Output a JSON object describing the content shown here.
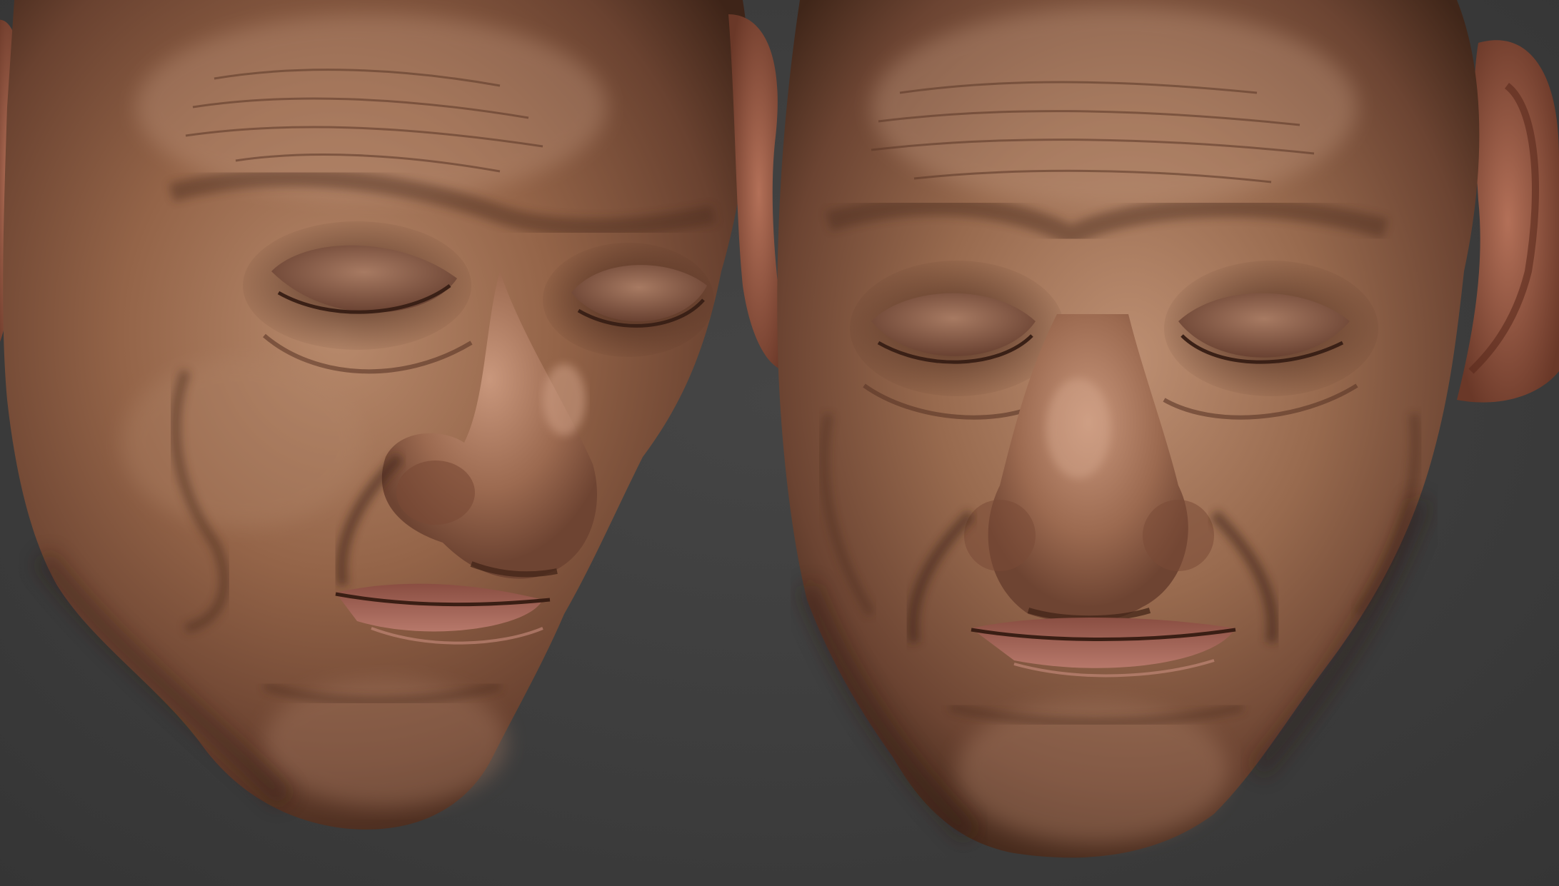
{
  "scene": {
    "background_color": "#3f3f3f",
    "skin_base": "#9a6a4e",
    "skin_shadow": "#4a2c1e",
    "skin_highlight": "#c4967a",
    "lip_color": "#a8665a",
    "subjects": [
      {
        "name": "sculpted-head-three-quarter",
        "icon": "head-render"
      },
      {
        "name": "sculpted-head-front",
        "icon": "head-render"
      }
    ]
  }
}
